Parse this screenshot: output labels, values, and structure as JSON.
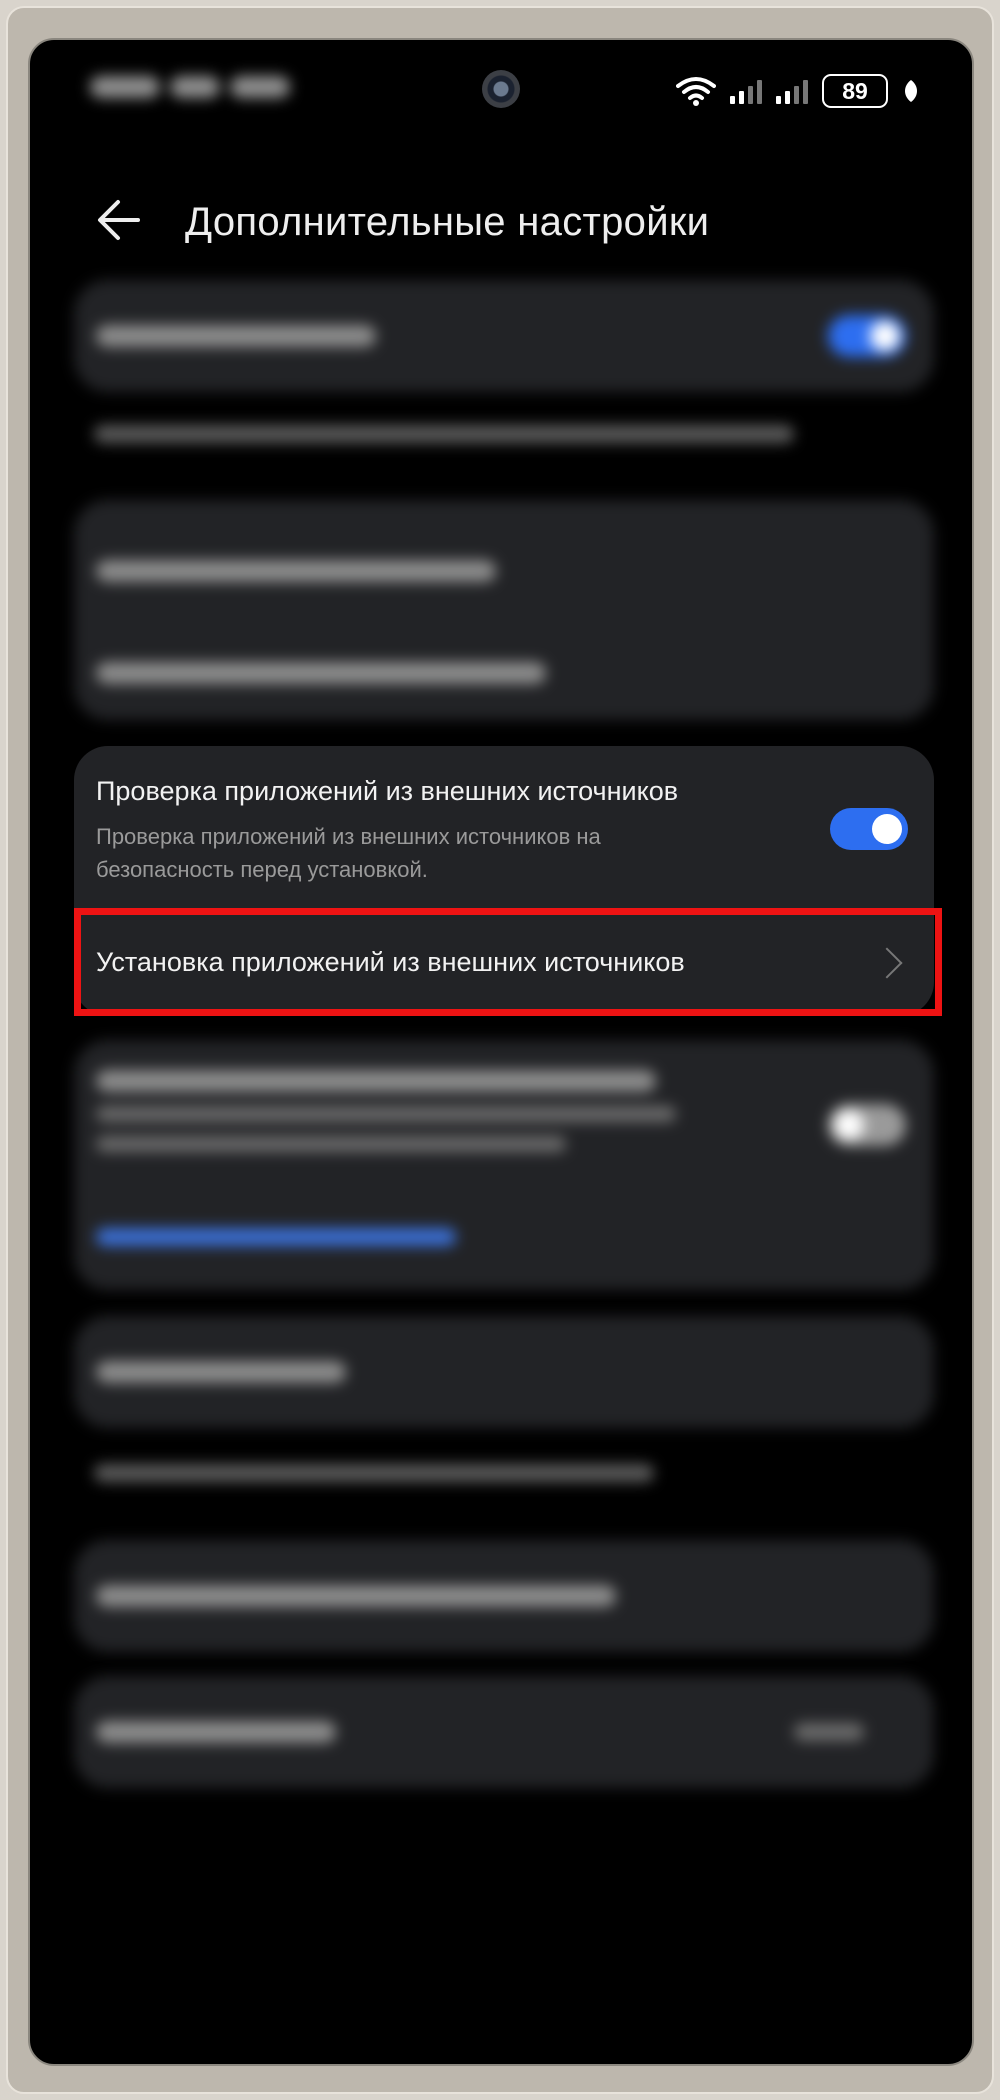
{
  "status_bar": {
    "battery": "89",
    "icons": [
      "wifi-icon",
      "signal-icon",
      "signal-icon",
      "battery-icon",
      "leaf-icon"
    ]
  },
  "header": {
    "title": "Дополнительные настройки",
    "back_icon": "arrow-left-icon"
  },
  "external_sources_card": {
    "verify_title": "Проверка приложений из внешних источников",
    "verify_desc": "Проверка приложений из внешних источников на безопасность перед установкой.",
    "verify_toggle_on": true,
    "install_label": "Установка приложений из внешних источников"
  },
  "colors": {
    "accent": "#2d6ef0",
    "highlight": "#ee1313",
    "card": "#222326",
    "background": "#000000"
  }
}
